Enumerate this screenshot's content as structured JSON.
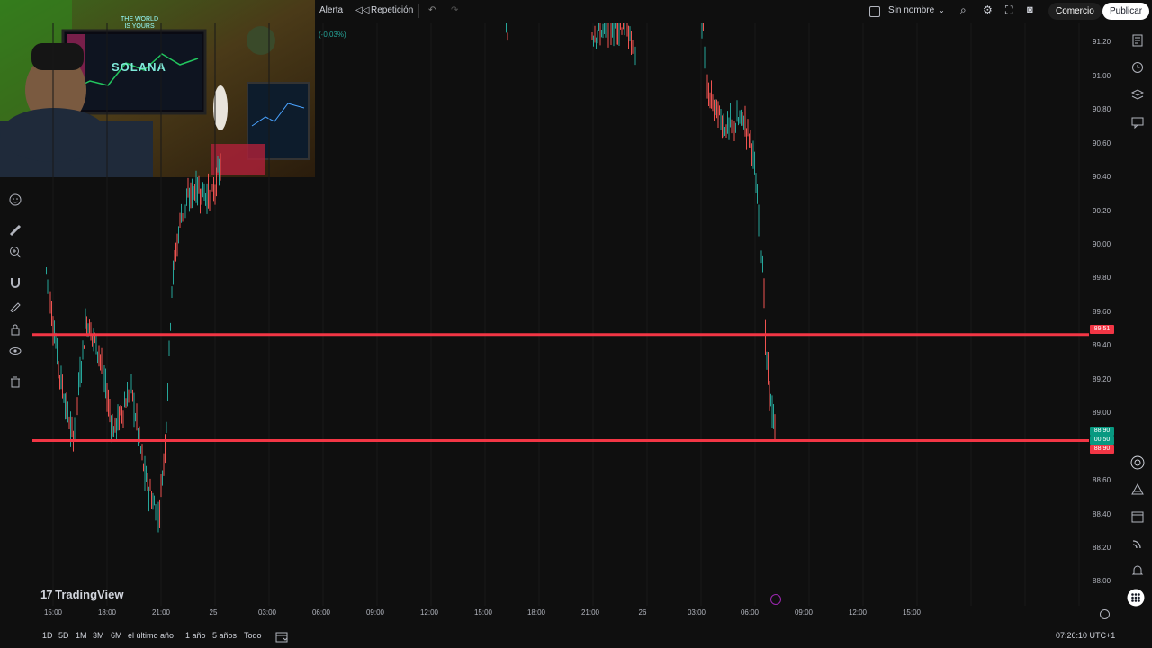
{
  "topbar": {
    "alert_label": "Alerta",
    "replay_label": "Repetición",
    "layout_name": "Sin nombre",
    "trade_label": "Comercio",
    "publish_label": "Publicar"
  },
  "change_badge": "(-0,03%)",
  "brand": {
    "logo_text": "TradingView"
  },
  "webcam": {
    "poster_line1": "THE WORLD",
    "poster_line2": "IS YOURS",
    "screen_text": "SOLANA"
  },
  "price_scale": {
    "labels": [
      "91.20",
      "91.00",
      "90.80",
      "90.60",
      "90.40",
      "90.20",
      "90.00",
      "89.80",
      "89.60",
      "89.40",
      "89.20",
      "89.00",
      "88.60",
      "88.40",
      "88.20",
      "88.00"
    ],
    "line_upper_tag": "89.51",
    "last_price_tag": "88.90",
    "countdown_tag": "00:50",
    "line_lower_tag": "88.90"
  },
  "time_axis": {
    "labels": [
      "15:00",
      "18:00",
      "21:00",
      "25",
      "03:00",
      "06:00",
      "09:00",
      "12:00",
      "15:00",
      "18:00",
      "21:00",
      "26",
      "03:00",
      "06:00",
      "09:00",
      "12:00",
      "15:00"
    ]
  },
  "bottombar": {
    "ranges": [
      "1D",
      "5D",
      "1M",
      "3M",
      "6M",
      "el último año",
      "1 año",
      "5 años",
      "Todo"
    ],
    "clock": "07:26:10 UTC+1"
  },
  "chart_data": {
    "type": "candlestick",
    "horizontal_lines": [
      89.51,
      88.9
    ],
    "last_price": 88.9,
    "ylim": [
      87.95,
      91.3
    ],
    "colors": {
      "up": "#26a69a",
      "down": "#ef5350",
      "line": "#f23645"
    }
  },
  "colors": {
    "accent": "#2962ff",
    "line_red": "#f23645",
    "green_tag": "#089981"
  }
}
